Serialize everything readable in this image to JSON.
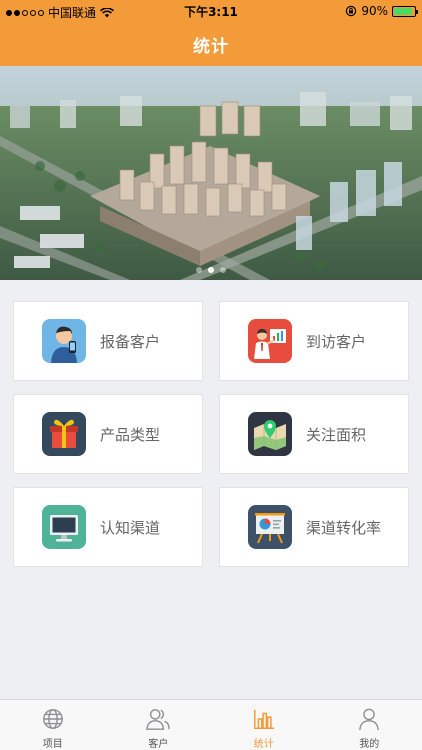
{
  "status_bar": {
    "carrier": "中国联通",
    "time": "下午3:11",
    "battery": "90%",
    "battery_level": 0.9
  },
  "header": {
    "title": "统计"
  },
  "banner": {
    "page_count": 3,
    "active_page": 2
  },
  "cards": [
    {
      "label": "报备客户",
      "icon": "person-phone-icon",
      "color": "#6fb6e6"
    },
    {
      "label": "到访客户",
      "icon": "presenter-chart-icon",
      "color": "#e74c3c"
    },
    {
      "label": "产品类型",
      "icon": "gift-box-icon",
      "color": "#34495e"
    },
    {
      "label": "关注面积",
      "icon": "map-pin-icon",
      "color": "#2f3542"
    },
    {
      "label": "认知渠道",
      "icon": "monitor-icon",
      "color": "#4fb39a"
    },
    {
      "label": "渠道转化率",
      "icon": "pie-chart-board-icon",
      "color": "#3d5168"
    }
  ],
  "tabs": [
    {
      "label": "项目",
      "icon": "globe-icon",
      "active": false
    },
    {
      "label": "客户",
      "icon": "users-icon",
      "active": false
    },
    {
      "label": "统计",
      "icon": "bar-chart-icon",
      "active": true
    },
    {
      "label": "我的",
      "icon": "user-icon",
      "active": false
    }
  ],
  "colors": {
    "accent": "#f29b38",
    "background": "#eeeff3"
  }
}
